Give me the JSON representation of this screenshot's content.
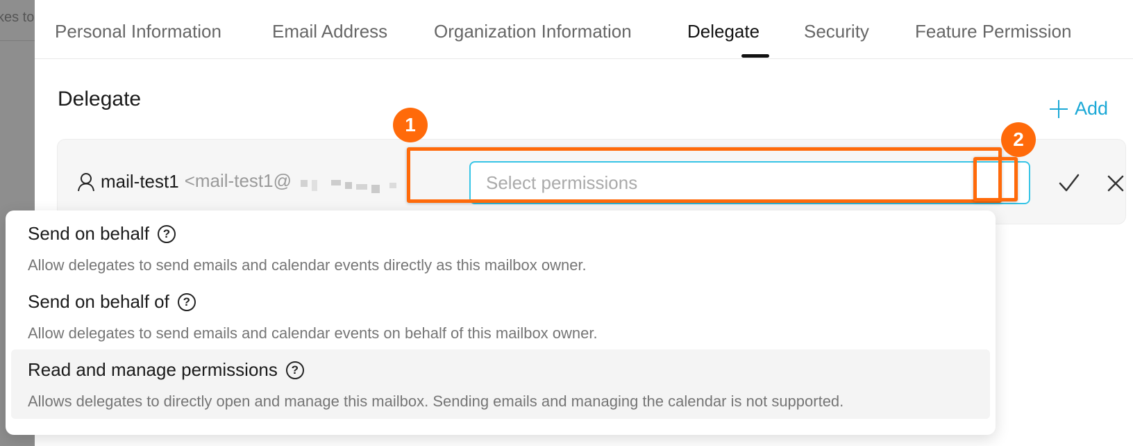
{
  "backdrop": {
    "partial_text": "kes to"
  },
  "tabs": [
    {
      "label": "Personal Information",
      "active": false
    },
    {
      "label": "Email Address",
      "active": false
    },
    {
      "label": "Organization Information",
      "active": false
    },
    {
      "label": "Delegate",
      "active": true
    },
    {
      "label": "Security",
      "active": false
    },
    {
      "label": "Feature Permission",
      "active": false
    }
  ],
  "section": {
    "title": "Delegate",
    "add_label": "Add"
  },
  "delegate": {
    "name": "mail-test1",
    "email_prefix": "<mail-test1@",
    "permission_placeholder": "Select permissions"
  },
  "annotations": {
    "marker1": "1",
    "marker2": "2"
  },
  "permissions": [
    {
      "title": "Send on behalf",
      "description": "Allow delegates to send emails and calendar events directly as this mailbox owner.",
      "hovered": false
    },
    {
      "title": "Send on behalf of",
      "description": "Allow delegates to send emails and calendar events on behalf of this mailbox owner.",
      "hovered": false
    },
    {
      "title": "Read and manage permissions",
      "description": "Allows delegates to directly open and manage this mailbox. Sending emails and managing the calendar is not supported.",
      "hovered": true
    }
  ],
  "colors": {
    "accent": "#1aa8d6",
    "focus_border": "#36c4e6",
    "annotation": "#ff6a0a"
  }
}
